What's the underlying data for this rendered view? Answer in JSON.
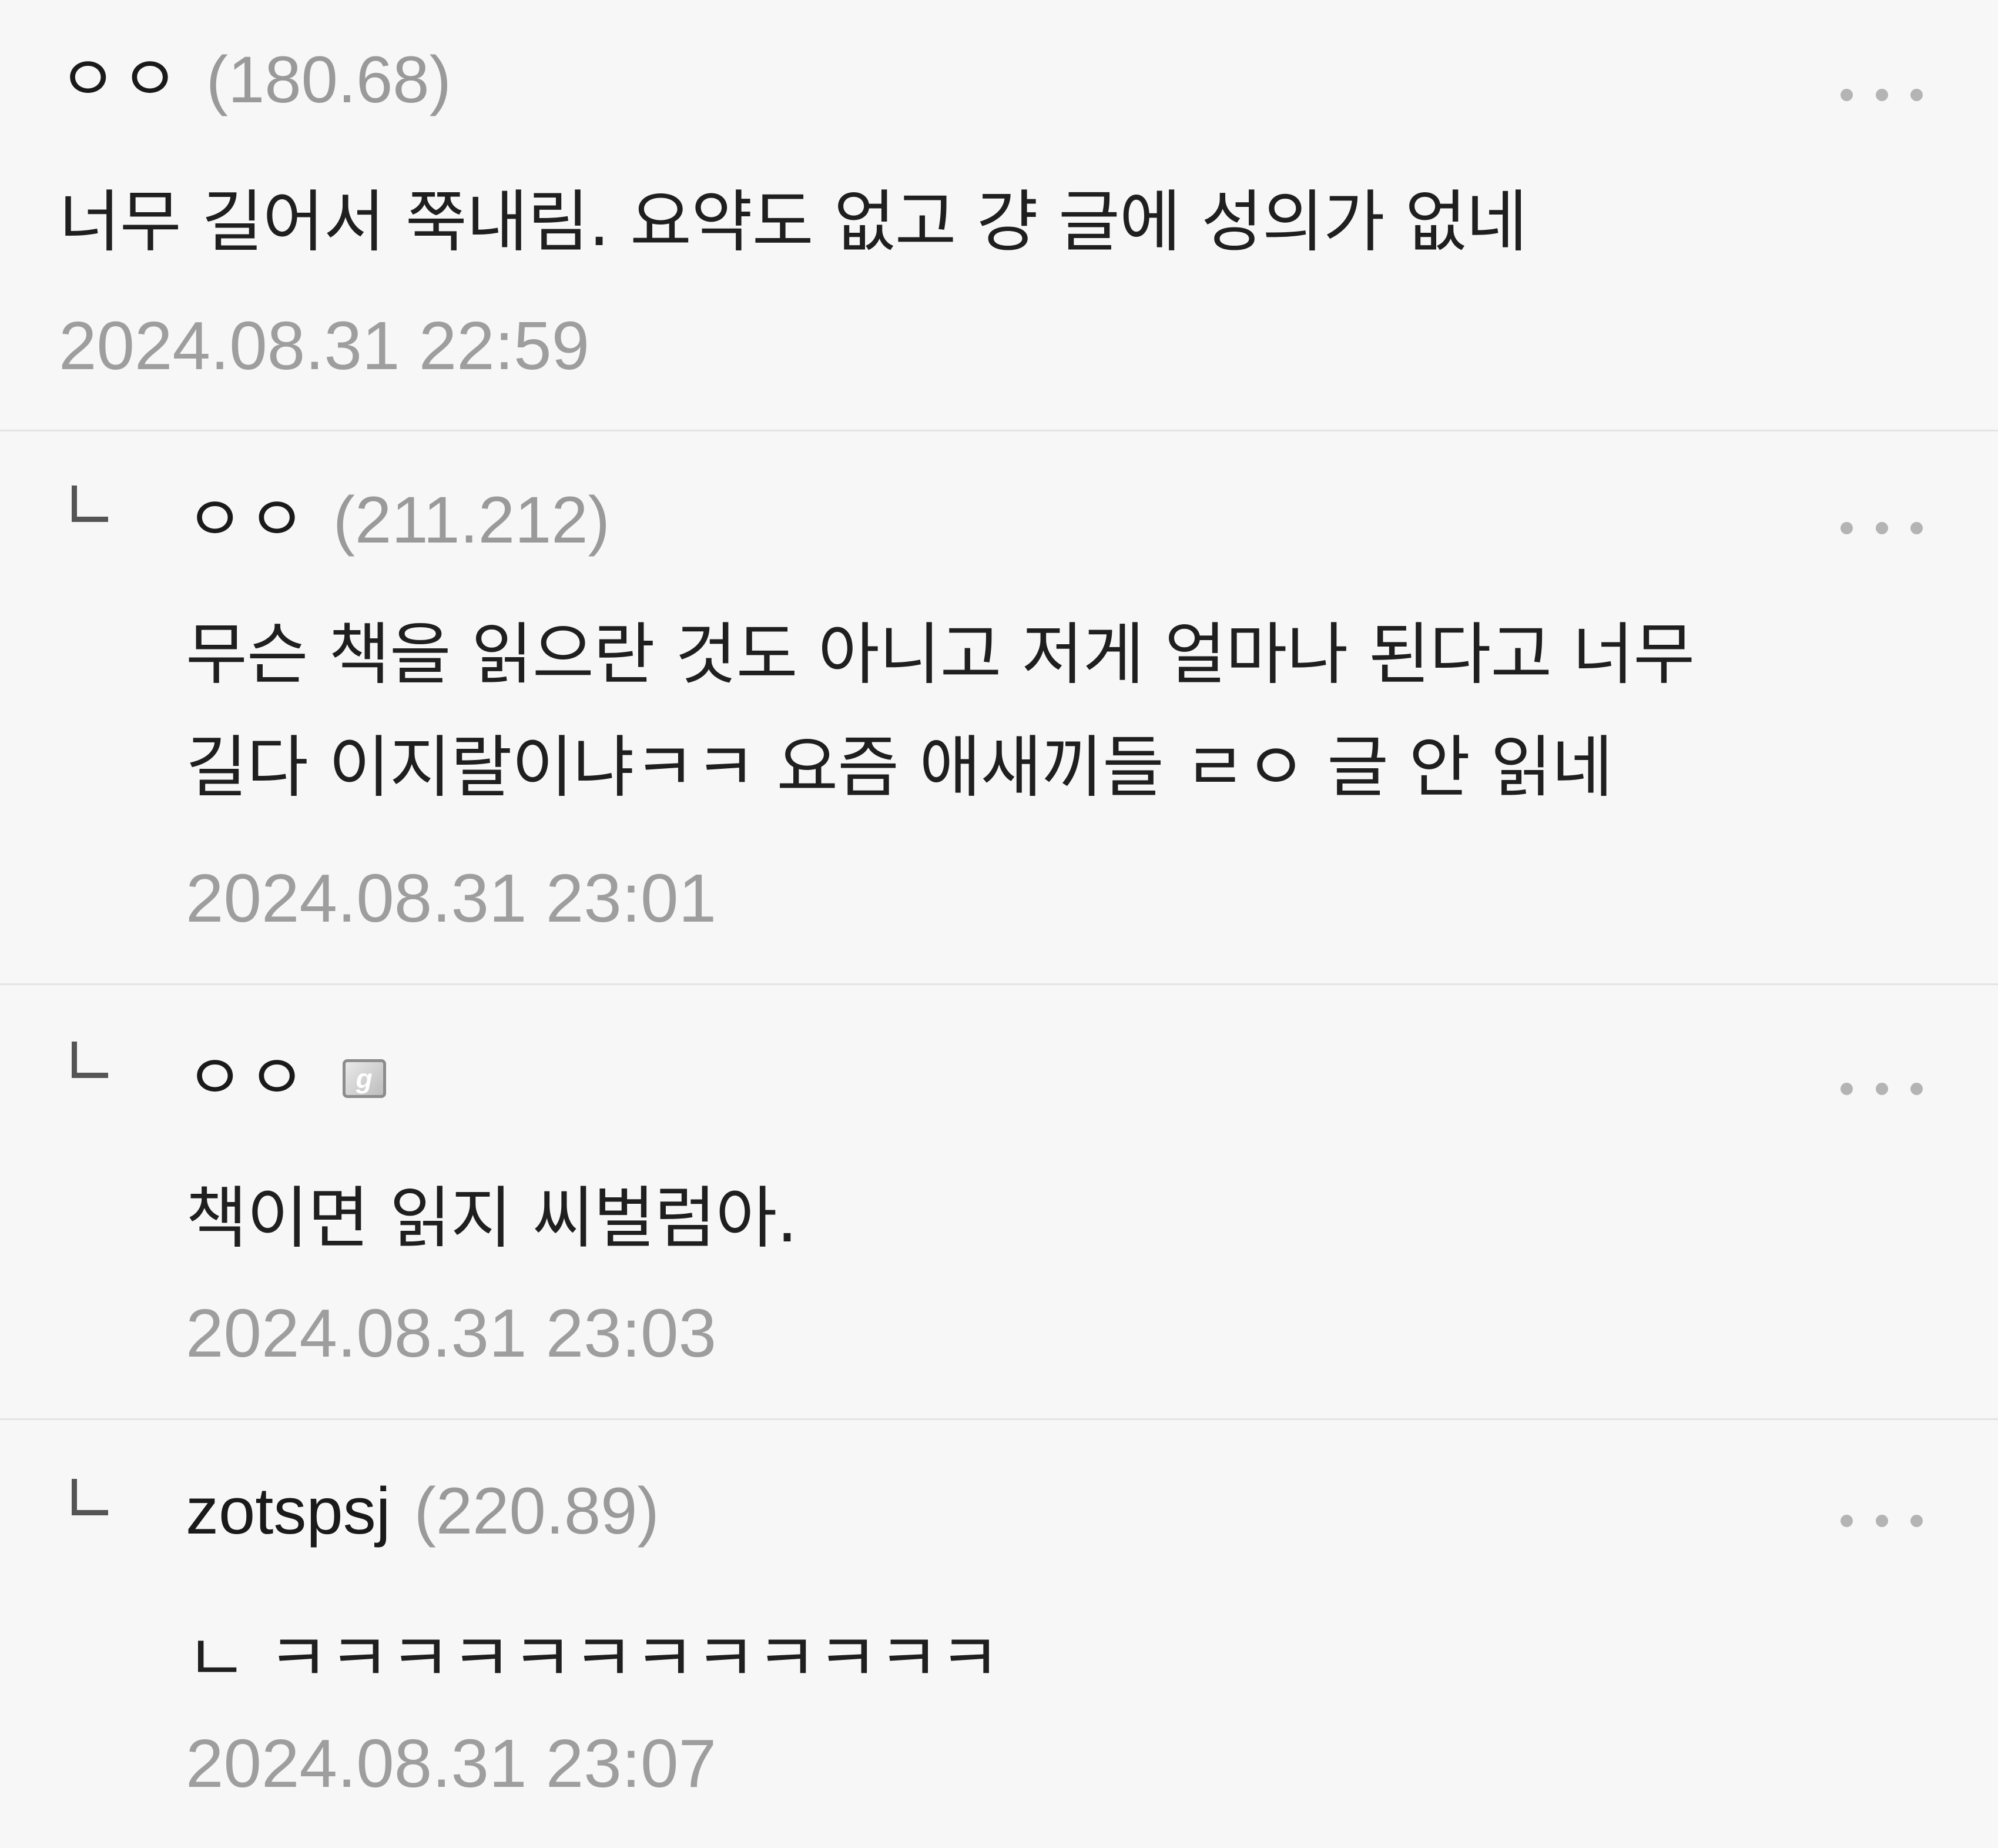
{
  "comments": [
    {
      "nickname": "ㅇㅇ",
      "ip": "(180.68)",
      "text": "너무 길어서 쭉내림. 요약도 없고 걍 글에 성의가 없네",
      "timestamp": "2024.08.31 22:59"
    },
    {
      "nickname": "ㅇㅇ",
      "ip": "(211.212)",
      "text_lines": [
        "무슨 책을 읽으란 것도 아니고 저게 얼마나 된다고 너무",
        "길다 이지랄이냐ㅋㅋ 요즘 애새끼들 ㄹㅇ 글 안 읽네"
      ],
      "timestamp": "2024.08.31 23:01"
    },
    {
      "nickname": "ㅇㅇ",
      "badge_icon": "fixed-member-badge-icon",
      "text": "책이면 읽지 씨벌럼아.",
      "timestamp": "2024.08.31 23:03"
    },
    {
      "nickname": "zotspsj",
      "ip": "(220.89)",
      "text": "ㄴ ㅋㅋㅋㅋㅋㅋㅋㅋㅋㅋㅋㅋ",
      "timestamp": "2024.08.31 23:07"
    }
  ],
  "icons": {
    "reply": "reply-arrow-icon",
    "more": "more-options-icon"
  },
  "colors": {
    "background": "#f7f7f7",
    "text": "#1a1a1a",
    "muted": "#9e9e9e",
    "divider": "#e4e4e4"
  }
}
